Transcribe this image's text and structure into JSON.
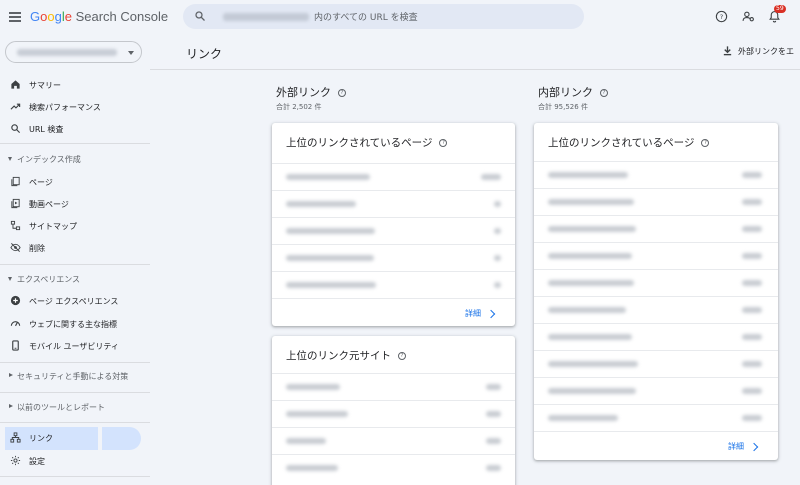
{
  "header": {
    "logo_google": "Google",
    "logo_product": "Search Console",
    "search_placeholder": "内のすべての URL を検査",
    "notification_count": "59"
  },
  "sidebar": {
    "items": [
      {
        "label": "サマリー",
        "icon": "home-icon"
      },
      {
        "label": "検索パフォーマンス",
        "icon": "trending-up-icon"
      },
      {
        "label": "URL 検査",
        "icon": "search-icon"
      }
    ],
    "section_index": "インデックス作成",
    "index_items": [
      {
        "label": "ページ",
        "icon": "pages-icon"
      },
      {
        "label": "動画ページ",
        "icon": "video-page-icon"
      },
      {
        "label": "サイトマップ",
        "icon": "sitemap-icon"
      },
      {
        "label": "削除",
        "icon": "visibility-off-icon"
      }
    ],
    "section_experience": "エクスペリエンス",
    "experience_items": [
      {
        "label": "ページ エクスペリエンス",
        "icon": "plus-circle-icon"
      },
      {
        "label": "ウェブに関する主な指標",
        "icon": "speed-gauge-icon"
      },
      {
        "label": "モバイル ユーザビリティ",
        "icon": "smartphone-icon"
      }
    ],
    "section_security": "セキュリティと手動による対策",
    "section_legacy": "以前のツールとレポート",
    "bottom_items": [
      {
        "label": "リンク",
        "icon": "links-icon"
      },
      {
        "label": "設定",
        "icon": "gear-icon"
      }
    ]
  },
  "page": {
    "title": "リンク",
    "export_label": "外部リンクをエ"
  },
  "external": {
    "title": "外部リンク",
    "total": "合計 2,502 件",
    "top_pages": {
      "title": "上位のリンクされているページ",
      "row_count": 5,
      "detail": "詳細"
    },
    "top_sites": {
      "title": "上位のリンク元サイト",
      "row_count": 4
    }
  },
  "internal": {
    "title": "内部リンク",
    "total": "合計 95,526 件",
    "top_pages": {
      "title": "上位のリンクされているページ",
      "row_count": 10,
      "detail": "詳細"
    }
  },
  "colors": {
    "accent": "#1a73e8",
    "background": "#f1f4f9",
    "active_nav": "#d3e3fd",
    "badge": "#d93025"
  }
}
